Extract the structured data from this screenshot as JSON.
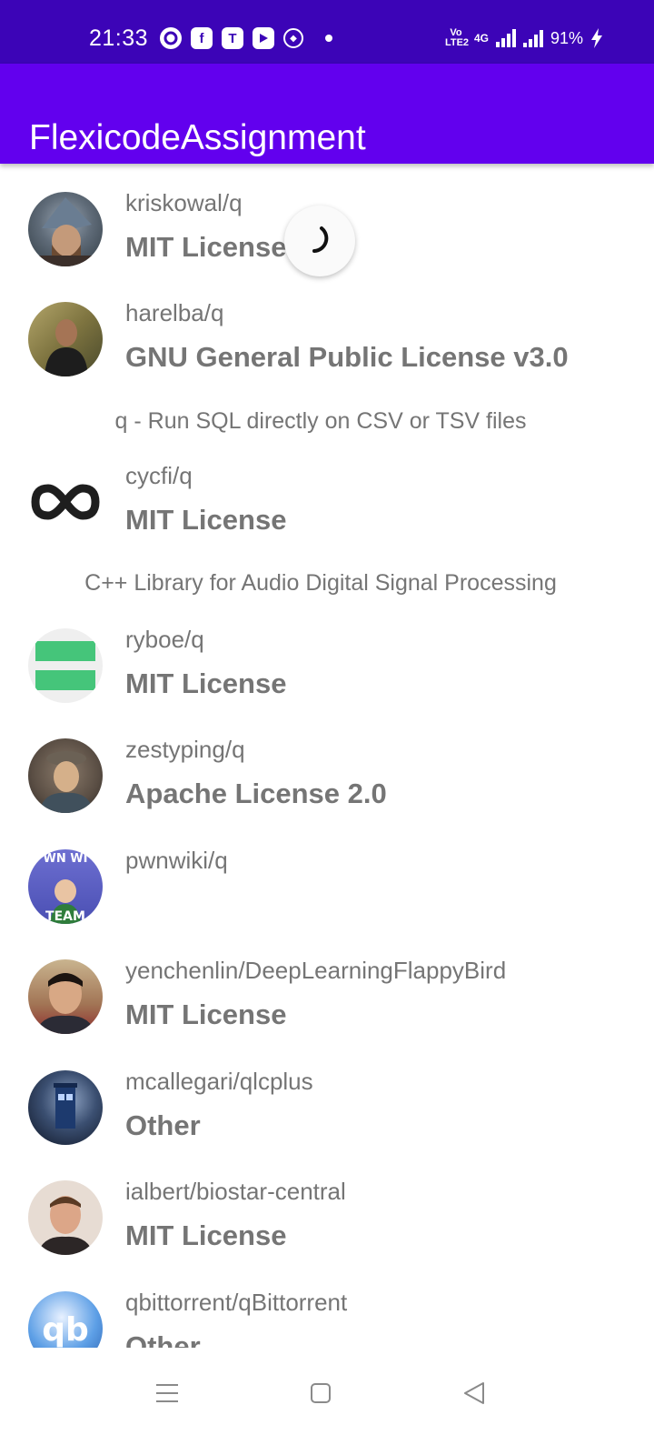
{
  "status_bar": {
    "time": "21:33",
    "app_icons": [
      "browser-icon",
      "facebook-icon",
      "teams-icon",
      "youtube-icon",
      "hexagon-app-icon"
    ],
    "volte_label": "Vo LTE2",
    "network_type": "4G",
    "battery_percent": "91%"
  },
  "app_bar": {
    "title": "FlexicodeAssignment"
  },
  "repos": [
    {
      "name": "kriskowal/q",
      "license": "MIT License",
      "description": ""
    },
    {
      "name": "harelba/q",
      "license": "GNU General Public License v3.0",
      "description": "q - Run SQL directly on CSV or TSV files"
    },
    {
      "name": "cycfi/q",
      "license": "MIT License",
      "description": "C++ Library for Audio Digital Signal Processing"
    },
    {
      "name": "ryboe/q",
      "license": "MIT License",
      "description": ""
    },
    {
      "name": "zestyping/q",
      "license": "Apache License 2.0",
      "description": ""
    },
    {
      "name": "pwnwiki/q",
      "license": "",
      "description": "",
      "avatar_text": [
        "WN WI",
        "TEAM"
      ]
    },
    {
      "name": "yenchenlin/DeepLearningFlappyBird",
      "license": "MIT License",
      "description": ""
    },
    {
      "name": "mcallegari/qlcplus",
      "license": "Other",
      "description": ""
    },
    {
      "name": "ialbert/biostar-central",
      "license": "MIT License",
      "description": ""
    },
    {
      "name": "qbittorrent/qBittorrent",
      "license": "Other",
      "description": "",
      "avatar_text": "qb"
    }
  ],
  "loading_indicator": {
    "visible": true
  },
  "nav_bar": {
    "buttons": [
      "menu-icon",
      "home-square-icon",
      "back-triangle-icon"
    ]
  },
  "colors": {
    "status_bar": "#3c04b7",
    "app_bar": "#6200ee",
    "text_secondary": "#757575"
  }
}
